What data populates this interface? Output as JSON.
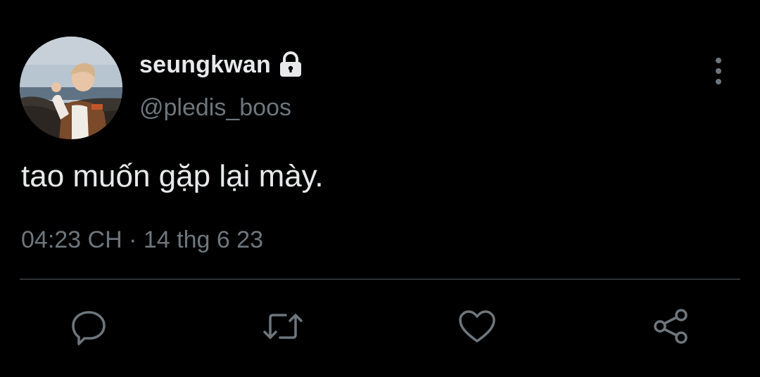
{
  "tweet": {
    "display_name": "seungkwan",
    "handle": "@pledis_boos",
    "text": "tao muốn gặp lại mày.",
    "timestamp": "04:23 CH · 14 thg 6 23",
    "protected_icon": "lock-icon"
  },
  "actions": [
    {
      "icon": "reply-icon"
    },
    {
      "icon": "retweet-icon"
    },
    {
      "icon": "like-icon"
    },
    {
      "icon": "share-icon"
    }
  ],
  "colors": {
    "background": "#000000",
    "primary_text": "#e7e9ea",
    "secondary_text": "#6e767d",
    "divider": "#2f3336"
  }
}
